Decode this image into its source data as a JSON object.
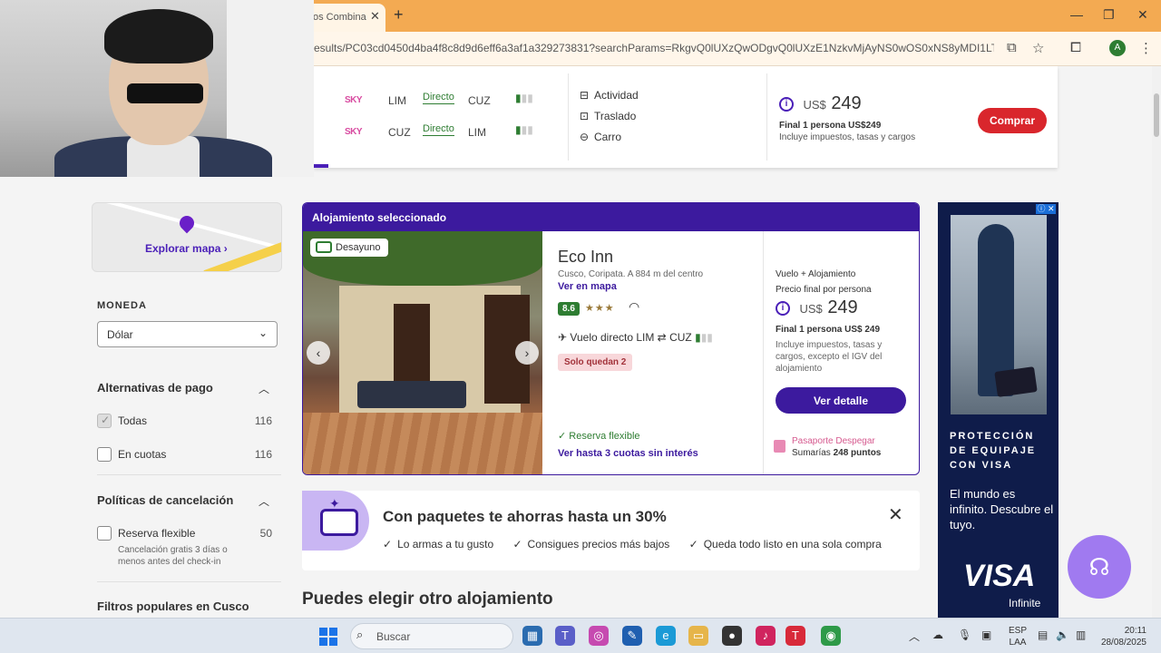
{
  "browser": {
    "tab_title": "os Combina",
    "url": "esults/PC03cd0450d4ba4f8c8d9d6eff6a3af1a329273831?searchParams=RkgvQ0lUXzQwODgvQ0lUXzE1NzkvMjAyNS0wOS0xNS8yMDI1LTA5LTIyL",
    "avatar_letter": "A"
  },
  "flight_summary": {
    "legs": [
      {
        "airline": "SKY",
        "from": "LIM",
        "type": "Directo",
        "to": "CUZ"
      },
      {
        "airline": "SKY",
        "from": "CUZ",
        "type": "Directo",
        "to": "LIM"
      }
    ],
    "extras": [
      "Actividad",
      "Traslado",
      "Carro"
    ],
    "currency": "US$",
    "price": "249",
    "final_text": "Final 1 persona US$249",
    "taxes_text": "Incluye impuestos, tasas y cargos",
    "buy_label": "Comprar"
  },
  "sidebar": {
    "map_label": "Explorar mapa ›",
    "currency_heading": "MONEDA",
    "currency_value": "Dólar",
    "payment_heading": "Alternativas de pago",
    "payment_options": [
      {
        "label": "Todas",
        "count": "116",
        "checked": true
      },
      {
        "label": "En cuotas",
        "count": "116",
        "checked": false
      }
    ],
    "cancel_heading": "Políticas de cancelación",
    "cancel_option": {
      "label": "Reserva flexible",
      "count": "50"
    },
    "cancel_desc": "Cancelación gratis 3 días o menos antes del check-in",
    "popular_heading": "Filtros populares en Cusco"
  },
  "hotel": {
    "header": "Alojamiento seleccionado",
    "badge": "Desayuno",
    "name": "Eco Inn",
    "location": "Cusco, Coripata. A 884 m del centro",
    "map_link": "Ver en mapa",
    "rating": "8.6",
    "stars": "★★★",
    "flight_text": "Vuelo directo LIM ⇄ CUZ",
    "availability": "Solo quedan 2",
    "flexible": "✓ Reserva flexible",
    "installments": "Ver hasta 3 cuotas sin interés",
    "package_label": "Vuelo + Alojamiento",
    "price_label": "Precio final por persona",
    "currency": "US$",
    "price": "249",
    "final_text": "Final 1 persona US$ 249",
    "taxes_text": "Incluye impuestos, tasas y cargos, excepto el IGV del alojamiento",
    "detail_label": "Ver detalle",
    "passport_label": "Pasaporte Despegar",
    "points_prefix": "Sumarías ",
    "points_value": "248 puntos"
  },
  "promo": {
    "title": "Con paquetes te ahorras hasta un 30%",
    "items": [
      "Lo armas a tu gusto",
      "Consigues precios más bajos",
      "Queda todo listo en una sola compra"
    ]
  },
  "other_title": "Puedes elegir otro alojamiento",
  "ad": {
    "headline": "PROTECCIÓN DE EQUIPAJE CON VISA",
    "tagline": "El mundo es infinito. Descubre el tuyo.",
    "brand": "VISA",
    "sub": "Infinite"
  },
  "taskbar": {
    "search_placeholder": "Buscar",
    "lang_top": "ESP",
    "lang_bottom": "LAA",
    "time": "20:11",
    "date": "28/08/2025"
  }
}
